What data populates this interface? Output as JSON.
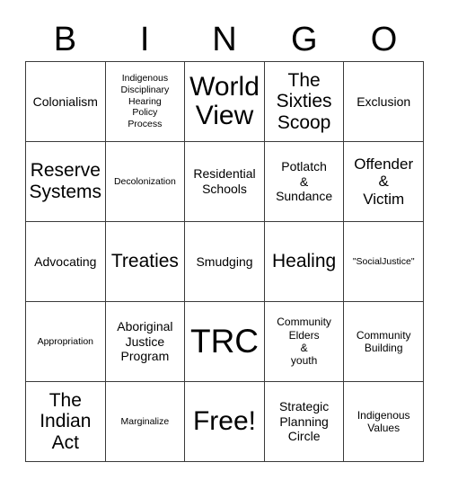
{
  "header": {
    "letters": [
      "B",
      "I",
      "N",
      "G",
      "O"
    ]
  },
  "grid": {
    "rows": 5,
    "columns": 5,
    "border_color": "#3a3a3a",
    "background_color": "#ffffff",
    "text_color": "#000000",
    "cells": [
      {
        "text": "Colonialism",
        "size": "fs-md"
      },
      {
        "text": "Indigenous\nDisciplinary\nHearing\nPolicy\nProcess",
        "size": "fs-xs"
      },
      {
        "text": "World\nView",
        "size": "fs-xxl"
      },
      {
        "text": "The\nSixties\nScoop",
        "size": "fs-xl"
      },
      {
        "text": "Exclusion",
        "size": "fs-md"
      },
      {
        "text": "Reserve\nSystems",
        "size": "fs-xl"
      },
      {
        "text": "Decolonization",
        "size": "fs-xs"
      },
      {
        "text": "Residential\nSchools",
        "size": "fs-md"
      },
      {
        "text": "Potlatch\n&\nSundance",
        "size": "fs-md"
      },
      {
        "text": "Offender\n&\nVictim",
        "size": "fs-lg"
      },
      {
        "text": "Advocating",
        "size": "fs-md"
      },
      {
        "text": "Treaties",
        "size": "fs-xl"
      },
      {
        "text": "Smudging",
        "size": "fs-md"
      },
      {
        "text": "Healing",
        "size": "fs-xl"
      },
      {
        "text": "\"SocialJustice\"",
        "size": "fs-xs"
      },
      {
        "text": "Appropriation",
        "size": "fs-xs"
      },
      {
        "text": "Aboriginal\nJustice\nProgram",
        "size": "fs-md"
      },
      {
        "text": "TRC",
        "size": "fs-huge"
      },
      {
        "text": "Community\nElders\n&\nyouth",
        "size": "fs-sm"
      },
      {
        "text": "Community\nBuilding",
        "size": "fs-sm"
      },
      {
        "text": "The\nIndian\nAct",
        "size": "fs-xl"
      },
      {
        "text": "Marginalize",
        "size": "fs-xs"
      },
      {
        "text": "Free!",
        "size": "fs-xxl"
      },
      {
        "text": "Strategic\nPlanning\nCircle",
        "size": "fs-md"
      },
      {
        "text": "Indigenous\nValues",
        "size": "fs-sm"
      }
    ]
  }
}
